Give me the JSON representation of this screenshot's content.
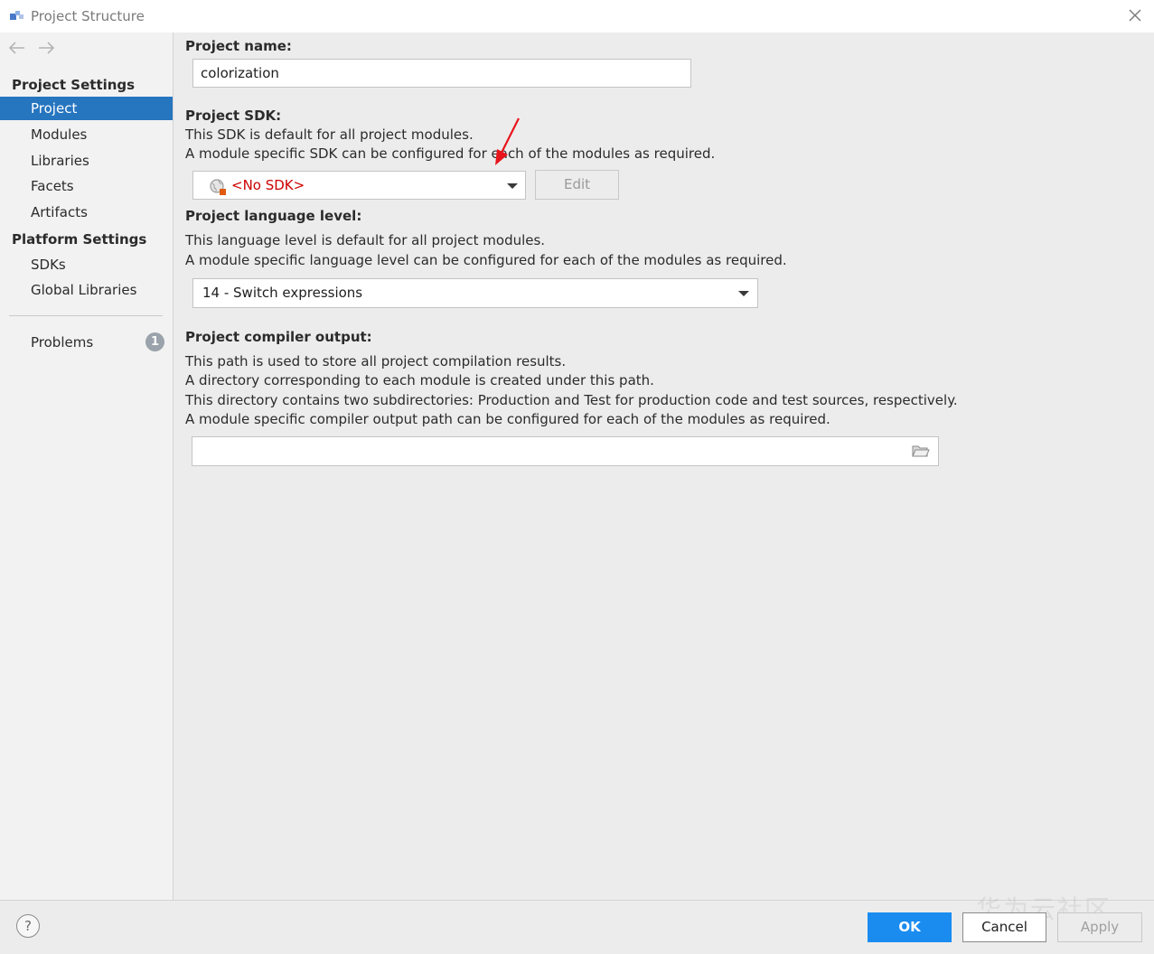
{
  "window": {
    "title": "Project Structure",
    "app_icon": "intellij-project-icon",
    "close_icon": "close-icon"
  },
  "sidebar": {
    "back_icon": "arrow-left-icon",
    "forward_icon": "arrow-right-icon",
    "project_settings_header": "Project Settings",
    "project_settings_items": [
      "Project",
      "Modules",
      "Libraries",
      "Facets",
      "Artifacts"
    ],
    "selected_item": "Project",
    "platform_settings_header": "Platform Settings",
    "platform_settings_items": [
      "SDKs",
      "Global Libraries"
    ],
    "problems_label": "Problems",
    "problems_count": "1"
  },
  "main": {
    "project_name_label": "Project name:",
    "project_name_value": "colorization",
    "sdk_label": "Project SDK:",
    "sdk_desc_1": "This SDK is default for all project modules.",
    "sdk_desc_2": "A module specific SDK can be configured for each of the modules as required.",
    "sdk_value": "<No SDK>",
    "sdk_value_color": "#cc0000",
    "sdk_icon": "globe-sdk-icon",
    "edit_button": "Edit",
    "lang_label": "Project language level:",
    "lang_desc_1": "This language level is default for all project modules.",
    "lang_desc_2": "A module specific language level can be configured for each of the modules as required.",
    "lang_value": "14 - Switch expressions",
    "output_label": "Project compiler output:",
    "output_desc_1": "This path is used to store all project compilation results.",
    "output_desc_2": "A directory corresponding to each module is created under this path.",
    "output_desc_3": "This directory contains two subdirectories: Production and Test for production code and test sources, respectively.",
    "output_desc_4": "A module specific compiler output path can be configured for each of the modules as required.",
    "output_value": "",
    "folder_icon": "folder-icon"
  },
  "footer": {
    "help_label": "?",
    "ok_label": "OK",
    "cancel_label": "Cancel",
    "apply_label": "Apply",
    "watermark": "华为云社区"
  },
  "colors": {
    "selection": "#2675bf",
    "ok_button": "#1a8cf0",
    "annotation_arrow": "#e8141c"
  }
}
